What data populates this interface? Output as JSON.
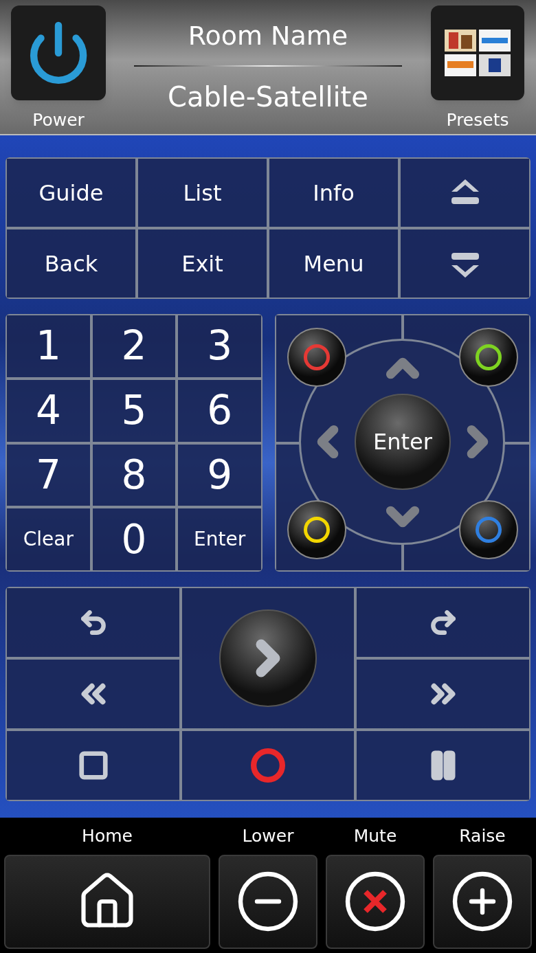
{
  "header": {
    "power_label": "Power",
    "room_name": "Room Name",
    "source": "Cable-Satellite",
    "presets_label": "Presets"
  },
  "nav_buttons": [
    {
      "kind": "text",
      "label": "Guide"
    },
    {
      "kind": "text",
      "label": "List"
    },
    {
      "kind": "text",
      "label": "Info"
    },
    {
      "kind": "page-up"
    },
    {
      "kind": "text",
      "label": "Back"
    },
    {
      "kind": "text",
      "label": "Exit"
    },
    {
      "kind": "text",
      "label": "Menu"
    },
    {
      "kind": "page-down"
    }
  ],
  "keypad": [
    {
      "label": "1",
      "kind": "digit"
    },
    {
      "label": "2",
      "kind": "digit"
    },
    {
      "label": "3",
      "kind": "digit"
    },
    {
      "label": "4",
      "kind": "digit"
    },
    {
      "label": "5",
      "kind": "digit"
    },
    {
      "label": "6",
      "kind": "digit"
    },
    {
      "label": "7",
      "kind": "digit"
    },
    {
      "label": "8",
      "kind": "digit"
    },
    {
      "label": "9",
      "kind": "digit"
    },
    {
      "label": "Clear",
      "kind": "word"
    },
    {
      "label": "0",
      "kind": "digit"
    },
    {
      "label": "Enter",
      "kind": "word"
    }
  ],
  "dpad": {
    "enter_label": "Enter",
    "color_buttons": [
      {
        "color": "#e53935"
      },
      {
        "color": "#7ed321"
      },
      {
        "color": "#f2d600"
      },
      {
        "color": "#2f7fe0"
      }
    ]
  },
  "transport": [
    {
      "kind": "replay"
    },
    {
      "kind": "skip"
    },
    {
      "kind": "rewind"
    },
    {
      "kind": "fast-forward"
    },
    {
      "kind": "stop"
    },
    {
      "kind": "record"
    },
    {
      "kind": "pause"
    }
  ],
  "play": {
    "kind": "play"
  },
  "footer": [
    {
      "kind": "home",
      "label": "Home"
    },
    {
      "kind": "lower",
      "label": "Lower"
    },
    {
      "kind": "mute",
      "label": "Mute"
    },
    {
      "kind": "raise",
      "label": "Raise"
    }
  ]
}
